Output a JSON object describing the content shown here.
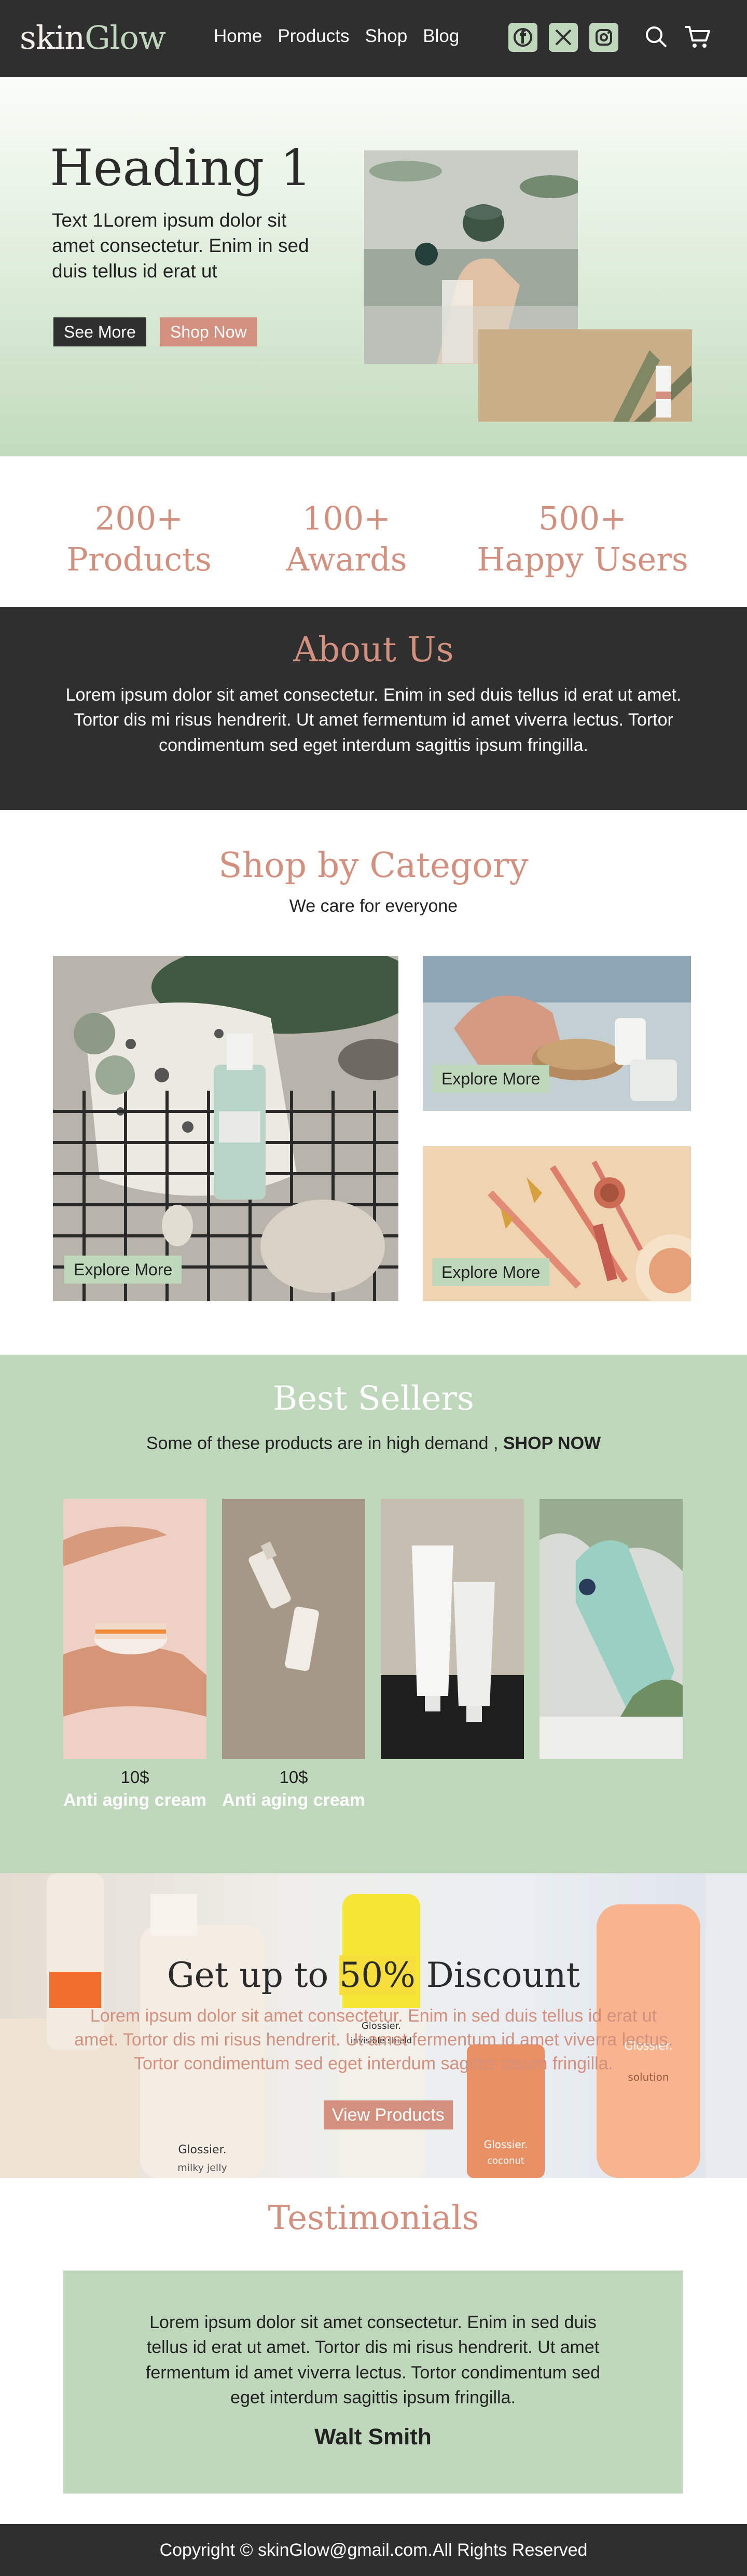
{
  "brand": {
    "part1": "skin",
    "part2": "Glow"
  },
  "nav": {
    "links": [
      "Home",
      "Products",
      "Shop",
      "Blog"
    ],
    "socials": [
      "facebook-icon",
      "x-icon",
      "instagram-icon"
    ],
    "tools": [
      "search-icon",
      "cart-icon"
    ]
  },
  "hero": {
    "heading": "Heading 1",
    "text": "Text 1Lorem ipsum dolor sit amet consectetur. Enim in sed duis tellus id erat ut",
    "see_more": "See More",
    "shop_now": "Shop Now"
  },
  "stats": [
    {
      "number": "200+",
      "label": "Products"
    },
    {
      "number": "100+",
      "label": "Awards"
    },
    {
      "number": "500+",
      "label": "Happy Users"
    }
  ],
  "about": {
    "title": "About Us",
    "text": "Lorem ipsum dolor sit amet consectetur. Enim in sed duis tellus id erat ut amet. Tortor dis mi risus hendrerit. Ut amet fermentum id amet viverra lectus. Tortor condimentum sed eget interdum sagittis ipsum fringilla."
  },
  "category": {
    "title": "Shop by Category",
    "subtitle": "We care for everyone",
    "cards": [
      {
        "button": "Explore More"
      },
      {
        "button": "Explore More"
      },
      {
        "button": "Explore More"
      }
    ]
  },
  "best": {
    "title": "Best Sellers",
    "subtitle": "Some of these products are in high demand , ",
    "subtitle_bold": "SHOP NOW",
    "products": [
      {
        "price": "10$",
        "name": "Anti aging cream"
      },
      {
        "price": "10$",
        "name": "Anti aging cream"
      },
      {
        "price": "",
        "name": ""
      },
      {
        "price": "",
        "name": ""
      }
    ]
  },
  "discount": {
    "title_before": "Get up to ",
    "title_highlight": "50%",
    "title_after": " Discount",
    "text": "Lorem ipsum dolor sit amet consectetur. Enim in sed duis tellus id erat ut amet. Tortor dis mi risus hendrerit. Ut amet fermentum id amet viverra lectus. Tortor condimentum sed eget interdum sagittis ipsum fringilla.",
    "button": "View Products",
    "packaging": {
      "brand": "Glossier.",
      "milky": "milky jelly",
      "solution": "solution",
      "coconut": "coconut",
      "shield": "invisible shield"
    }
  },
  "testimonials": {
    "title": "Testimonials",
    "quote": "Lorem ipsum dolor sit amet consectetur. Enim in sed duis tellus id erat ut amet. Tortor dis mi risus hendrerit. Ut amet fermentum id amet viverra lectus. Tortor condimentum sed eget interdum sagittis ipsum fringilla.",
    "author": "Walt Smith"
  },
  "footer": {
    "text": "Copyright © skinGlow@gmail.com.All Rights Reserved"
  },
  "colors": {
    "dark": "#2f2f2f",
    "sage": "#bfd8bc",
    "rose": "#d4907f",
    "highlight": "#f6df3a"
  }
}
